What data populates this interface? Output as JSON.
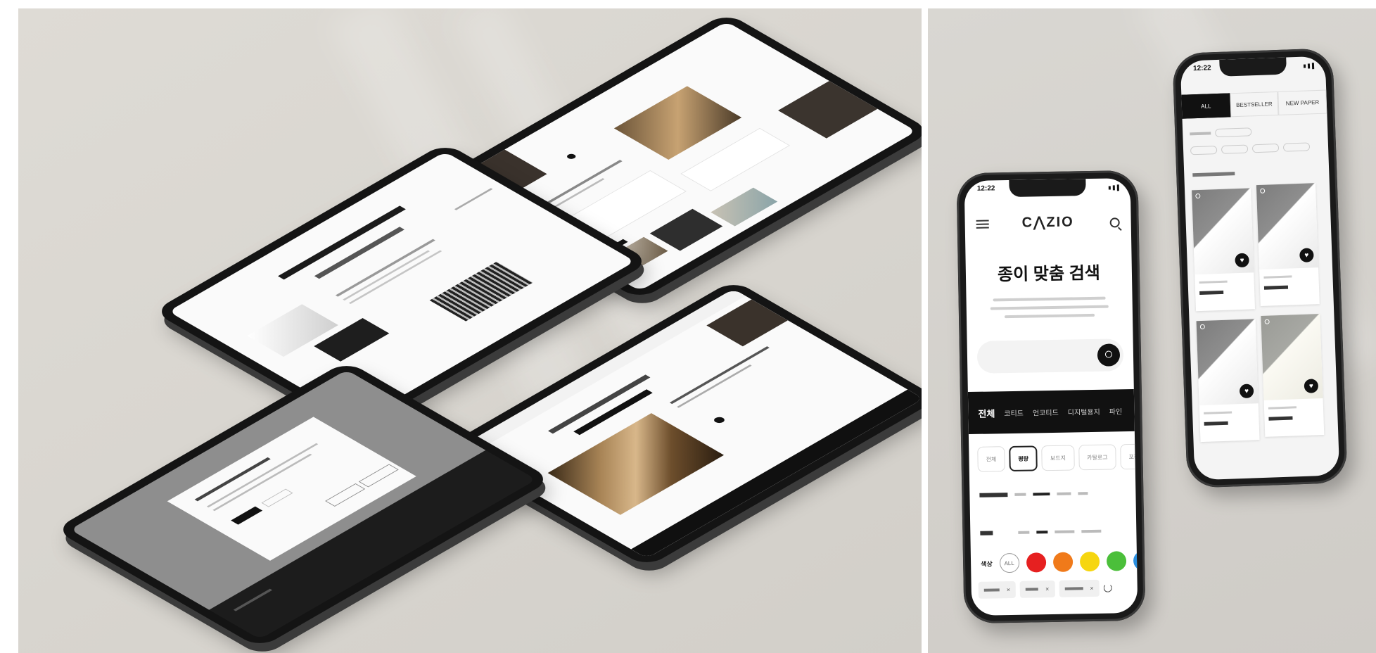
{
  "title": "",
  "colors": {
    "bg_left": "#dbd8d2",
    "bg_right": "#d6d3ce",
    "device": "#141414",
    "accent": "#111111"
  },
  "phone_main": {
    "time": "12:22",
    "logo": "C⋀ZIO",
    "logo_sub": "",
    "hero_title": "종이 맞춤 검색",
    "search_placeholder": "",
    "category_tabs": [
      "전체",
      "코티드",
      "언코티드",
      "디지털용지",
      "파인"
    ],
    "material_chips": [
      "전체",
      "평량",
      "보드지",
      "카탈로그",
      "포장용"
    ],
    "filters": [
      {
        "label": "",
        "options": [
          "",
          "",
          ""
        ]
      },
      {
        "label": "",
        "options": [
          "",
          "",
          ""
        ]
      }
    ],
    "color_filter_label": "색상",
    "color_all": "ALL",
    "color_swatches": [
      "#e62020",
      "#f07a1a",
      "#f6d60f",
      "#4bbf3a",
      "#2a8fe0"
    ],
    "selected_tags": [
      "",
      "",
      ""
    ],
    "icons": [
      "hamburger-icon",
      "search-icon",
      "close-icon",
      "refresh-icon"
    ]
  },
  "phone_secondary": {
    "time": "12:22",
    "tabs": [
      "ALL",
      "BESTSELLER",
      "NEW PAPER"
    ],
    "products": [
      {
        "subtitle": "",
        "name": "",
        "tone": "dark"
      },
      {
        "subtitle": "",
        "name": "",
        "tone": "dark"
      },
      {
        "subtitle": "",
        "name": "",
        "tone": "dark"
      },
      {
        "subtitle": "",
        "name": "",
        "tone": "light"
      }
    ],
    "icons": [
      "heart-icon"
    ]
  },
  "tablets": [
    {
      "id": "tablet-top-right",
      "heading": ""
    },
    {
      "id": "tablet-middle",
      "heading": "",
      "subheading": ""
    },
    {
      "id": "tablet-bottom-right",
      "heading": ""
    },
    {
      "id": "tablet-bottom-left",
      "modal_title": ""
    }
  ]
}
